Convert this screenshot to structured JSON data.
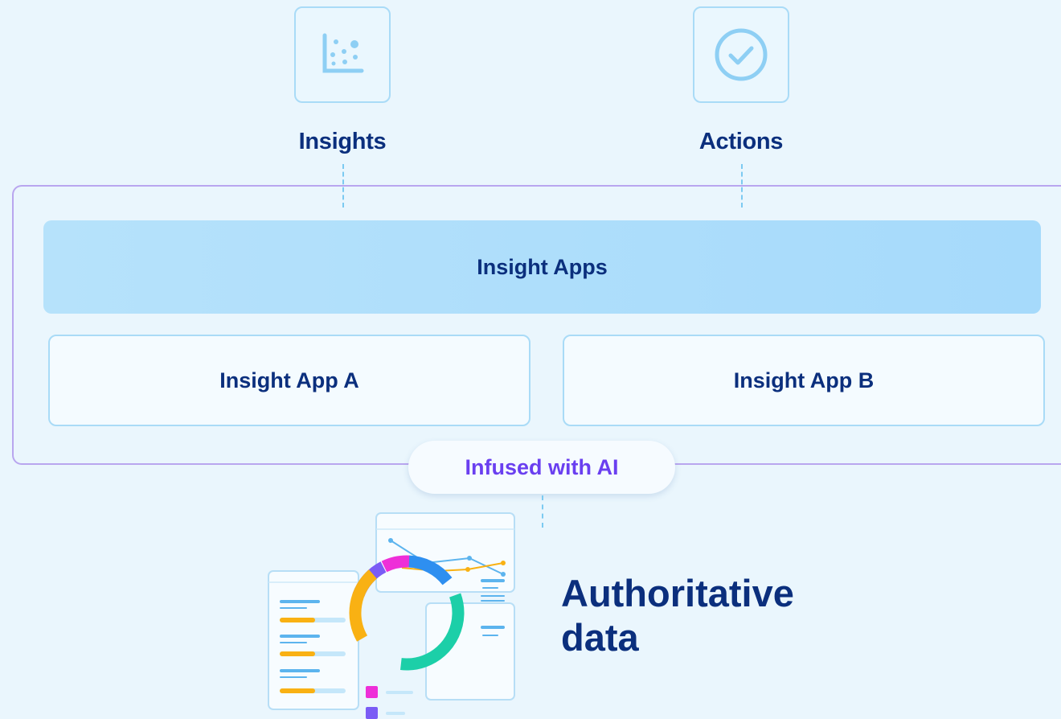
{
  "top": {
    "insights": {
      "label": "Insights",
      "icon": "scatter-chart-icon"
    },
    "actions": {
      "label": "Actions",
      "icon": "check-circle-icon"
    }
  },
  "platform": {
    "bar_label": "Insight Apps",
    "app_a": "Insight App A",
    "app_b": "Insight App B",
    "ai_label": "Infused with AI"
  },
  "data_section": {
    "title_line1": "Authoritative",
    "title_line2": "data"
  },
  "colors": {
    "background": "#eaf6fd",
    "navy_text": "#0b2f7d",
    "ai_purple": "#6a3ff0",
    "frame_purple": "#b9a6ef",
    "light_blue": "#a9dbf7",
    "donut_blue": "#2e8ff0",
    "donut_green": "#1ccfa8",
    "donut_orange": "#f9b113",
    "donut_purple": "#7a5cf5",
    "donut_magenta": "#ee2fd8"
  }
}
